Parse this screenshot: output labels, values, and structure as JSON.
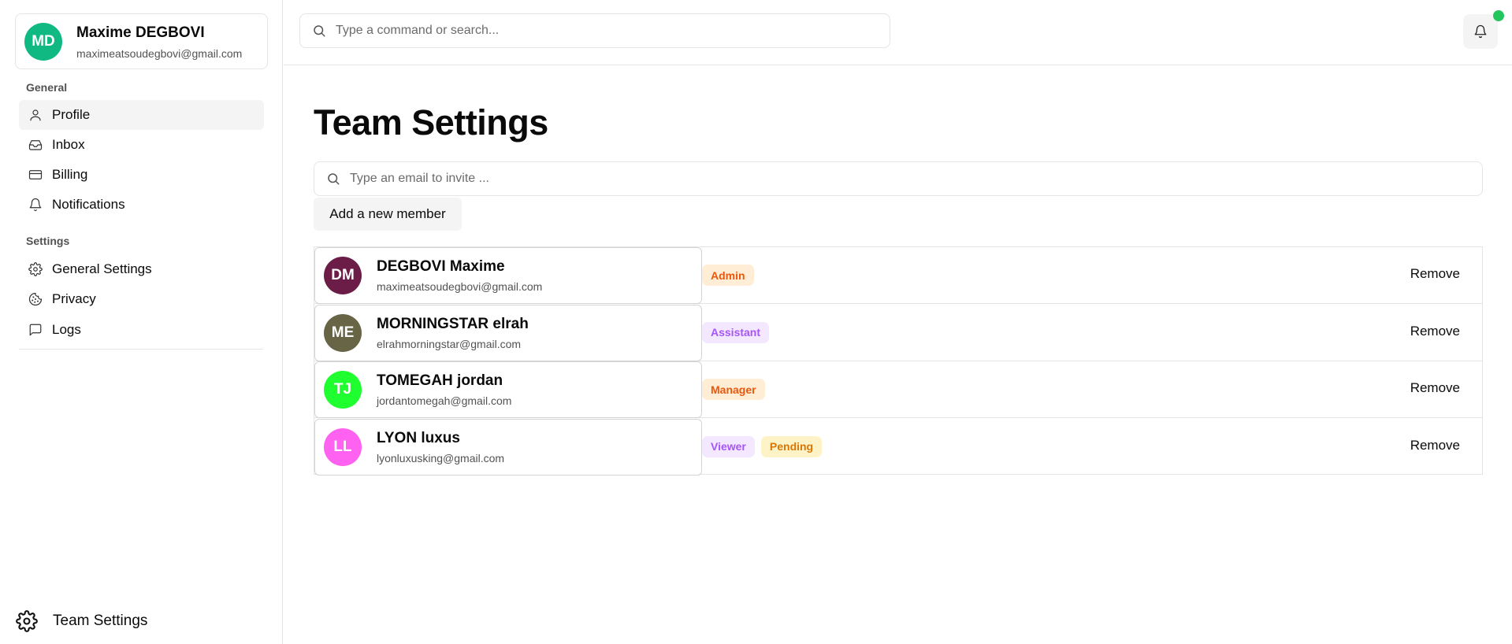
{
  "sidebar": {
    "user": {
      "initials": "MD",
      "name": "Maxime DEGBOVI",
      "email": "maximeatsoudegbovi@gmail.com",
      "avatar_color": "#10b981"
    },
    "groups": [
      {
        "label": "General",
        "items": [
          {
            "label": "Profile",
            "icon": "user-icon",
            "active": true
          },
          {
            "label": "Inbox",
            "icon": "inbox-icon"
          },
          {
            "label": "Billing",
            "icon": "credit-card-icon"
          },
          {
            "label": "Notifications",
            "icon": "bell-icon"
          }
        ]
      },
      {
        "label": "Settings",
        "items": [
          {
            "label": "General Settings",
            "icon": "gear-icon"
          },
          {
            "label": "Privacy",
            "icon": "cookie-icon"
          },
          {
            "label": "Logs",
            "icon": "message-icon"
          }
        ]
      }
    ],
    "footer": {
      "label": "Team Settings",
      "icon": "gear-icon"
    }
  },
  "topbar": {
    "search_placeholder": "Type a command or search...",
    "notification_indicator_color": "#22c55e"
  },
  "main": {
    "title": "Team Settings",
    "invite_placeholder": "Type an email to invite ...",
    "add_button_label": "Add a new member",
    "members": [
      {
        "initials": "DM",
        "name": "DEGBOVI Maxime",
        "email": "maximeatsoudegbovi@gmail.com",
        "avatar_color": "#6b1d48",
        "badges": [
          {
            "label": "Admin",
            "bg": "#ffedd5",
            "fg": "#ea580c"
          }
        ],
        "remove_label": "Remove"
      },
      {
        "initials": "ME",
        "name": "MORNINGSTAR elrah",
        "email": "elrahmorningstar@gmail.com",
        "avatar_color": "#686446",
        "badges": [
          {
            "label": "Assistant",
            "bg": "#f3e8ff",
            "fg": "#a855f7"
          }
        ],
        "remove_label": "Remove"
      },
      {
        "initials": "TJ",
        "name": "TOMEGAH jordan",
        "email": "jordantomegah@gmail.com",
        "avatar_color": "#1fff2f",
        "badges": [
          {
            "label": "Manager",
            "bg": "#ffedd5",
            "fg": "#ea580c"
          }
        ],
        "remove_label": "Remove"
      },
      {
        "initials": "LL",
        "name": "LYON luxus",
        "email": "lyonluxusking@gmail.com",
        "avatar_color": "#ff62f0",
        "badges": [
          {
            "label": "Viewer",
            "bg": "#f3e8ff",
            "fg": "#a855f7"
          },
          {
            "label": "Pending",
            "bg": "#fef3c7",
            "fg": "#d97706"
          }
        ],
        "remove_label": "Remove"
      }
    ]
  }
}
